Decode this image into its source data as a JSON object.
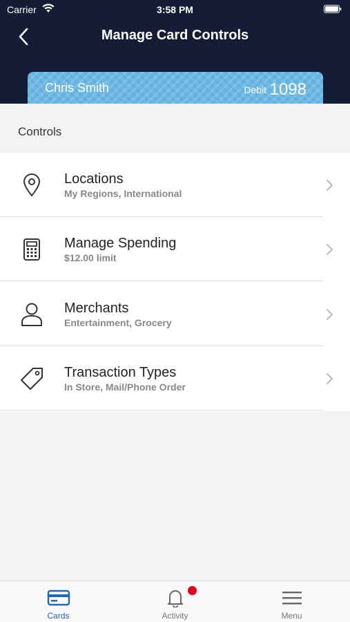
{
  "status_bar": {
    "carrier": "Carrier",
    "time": "3:58 PM"
  },
  "header": {
    "title": "Manage Card Controls",
    "back_icon": "chevron-left-icon"
  },
  "card": {
    "holder": "Chris Smith",
    "type": "Debit",
    "last4": "1098",
    "color": "#6bb8e3"
  },
  "controls": {
    "section_label": "Controls",
    "items": [
      {
        "title": "Locations",
        "subtitle": "My Regions, International",
        "icon": "location-pin-icon"
      },
      {
        "title": "Manage Spending",
        "subtitle": "$12.00 limit",
        "icon": "calculator-icon"
      },
      {
        "title": "Merchants",
        "subtitle": "Entertainment, Grocery",
        "icon": "person-icon"
      },
      {
        "title": "Transaction Types",
        "subtitle": "In Store, Mail/Phone Order",
        "icon": "tag-icon"
      }
    ]
  },
  "tabbar": {
    "tabs": [
      {
        "label": "Cards",
        "icon": "credit-card-icon",
        "active": true
      },
      {
        "label": "Activity",
        "icon": "bell-icon",
        "active": false,
        "badge": true
      },
      {
        "label": "Menu",
        "icon": "hamburger-menu-icon",
        "active": false
      }
    ]
  },
  "colors": {
    "header_bg": "#141c36",
    "accent": "#2266b8",
    "badge": "#e6001b"
  }
}
